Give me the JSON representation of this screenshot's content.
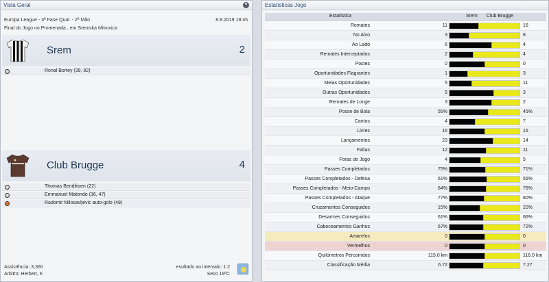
{
  "left_panel": {
    "title": "Vista Geral",
    "competition": "Europa League - 3ª Fase Qual. - 2ª Mão",
    "datetime": "8.8.2019 19:45",
    "venue": "Final do Jogo no Promenada , em Sremska Mitrovica",
    "home": {
      "name": "Srem",
      "score": "2",
      "kit_colors": [
        "#111111",
        "#f2f2f2"
      ],
      "scorers": [
        "Ronal Bortey (39, 82)"
      ]
    },
    "away": {
      "name": "Club Brugge",
      "score": "4",
      "kit_colors": [
        "#5b3a30",
        "#7a5246"
      ],
      "scorers": [
        "Thomas Bendiksen (22)",
        "Emmanuel Matondo (36, 47)",
        "Radomir Milosavljevic auto-golo (49)"
      ]
    },
    "attendance": "Assistência: 3,360",
    "referee": "Arbitro: Herbert, K",
    "halftime": "esultado ao intervalo: 1:2",
    "weather": "Seco 19ºC"
  },
  "right_panel": {
    "title": "Estatísticas Jogo",
    "col_stat": "Estatística",
    "col_home": "Srem",
    "col_away": "Club Brugge",
    "rows": [
      {
        "label": "Remates",
        "home": "11",
        "away": "16",
        "h": 11,
        "a": 16
      },
      {
        "label": "No Alvo",
        "home": "3",
        "away": "8",
        "h": 3,
        "a": 8
      },
      {
        "label": "Ao Lado",
        "home": "6",
        "away": "4",
        "h": 6,
        "a": 4
      },
      {
        "label": "Remates Interceptados",
        "home": "2",
        "away": "4",
        "h": 2,
        "a": 4
      },
      {
        "label": "Postes",
        "home": "0",
        "away": "0",
        "h": 0,
        "a": 0
      },
      {
        "label": "Oportunidades Flagrantes",
        "home": "1",
        "away": "3",
        "h": 1,
        "a": 3
      },
      {
        "label": "Meias Oportunidades",
        "home": "5",
        "away": "11",
        "h": 5,
        "a": 11
      },
      {
        "label": "Outras Oportunidades",
        "home": "5",
        "away": "3",
        "h": 5,
        "a": 3
      },
      {
        "label": "Remates de Longe",
        "home": "3",
        "away": "2",
        "h": 3,
        "a": 2
      },
      {
        "label": "Posse de Bola",
        "home": "55%",
        "away": "45%",
        "h": 55,
        "a": 45
      },
      {
        "label": "Cantos",
        "home": "4",
        "away": "7",
        "h": 4,
        "a": 7
      },
      {
        "label": "Livres",
        "home": "16",
        "away": "16",
        "h": 16,
        "a": 16
      },
      {
        "label": "Lançamentos",
        "home": "23",
        "away": "14",
        "h": 23,
        "a": 14
      },
      {
        "label": "Faltas",
        "home": "12",
        "away": "11",
        "h": 12,
        "a": 11
      },
      {
        "label": "Foras de Jogo",
        "home": "4",
        "away": "5",
        "h": 4,
        "a": 5
      },
      {
        "label": "Passes Completados",
        "home": "75%",
        "away": "71%",
        "h": 75,
        "a": 71
      },
      {
        "label": "Passes Completados - Defesa",
        "home": "61%",
        "away": "55%",
        "h": 61,
        "a": 55
      },
      {
        "label": "Passes Completados - Meio-Campo",
        "home": "84%",
        "away": "78%",
        "h": 84,
        "a": 78
      },
      {
        "label": "Passes Completados - Ataque",
        "home": "77%",
        "away": "80%",
        "h": 77,
        "a": 80
      },
      {
        "label": "Cruzamentos Conseguidos",
        "home": "15%",
        "away": "20%",
        "h": 15,
        "a": 20
      },
      {
        "label": "Desarmes Conseguidos",
        "home": "61%",
        "away": "66%",
        "h": 61,
        "a": 66
      },
      {
        "label": "Cabeceamentos Ganhos",
        "home": "67%",
        "away": "72%",
        "h": 67,
        "a": 72
      },
      {
        "label": "Amarelos",
        "home": "0",
        "away": "0",
        "h": 0,
        "a": 0,
        "highlight": "yellow"
      },
      {
        "label": "Vermelhos",
        "home": "0",
        "away": "0",
        "h": 0,
        "a": 0,
        "highlight": "red"
      },
      {
        "label": "Quilómetros Percorridos",
        "home": "115.0 km",
        "away": "116.0 km",
        "h": 115,
        "a": 116
      },
      {
        "label": "Classificação Média",
        "home": "6.72",
        "away": "7.27",
        "h": 6.72,
        "a": 7.27
      }
    ]
  },
  "colors": {
    "home_bar": "#050505",
    "away_bar": "#e9e81a",
    "accent": "#2b4d78"
  }
}
